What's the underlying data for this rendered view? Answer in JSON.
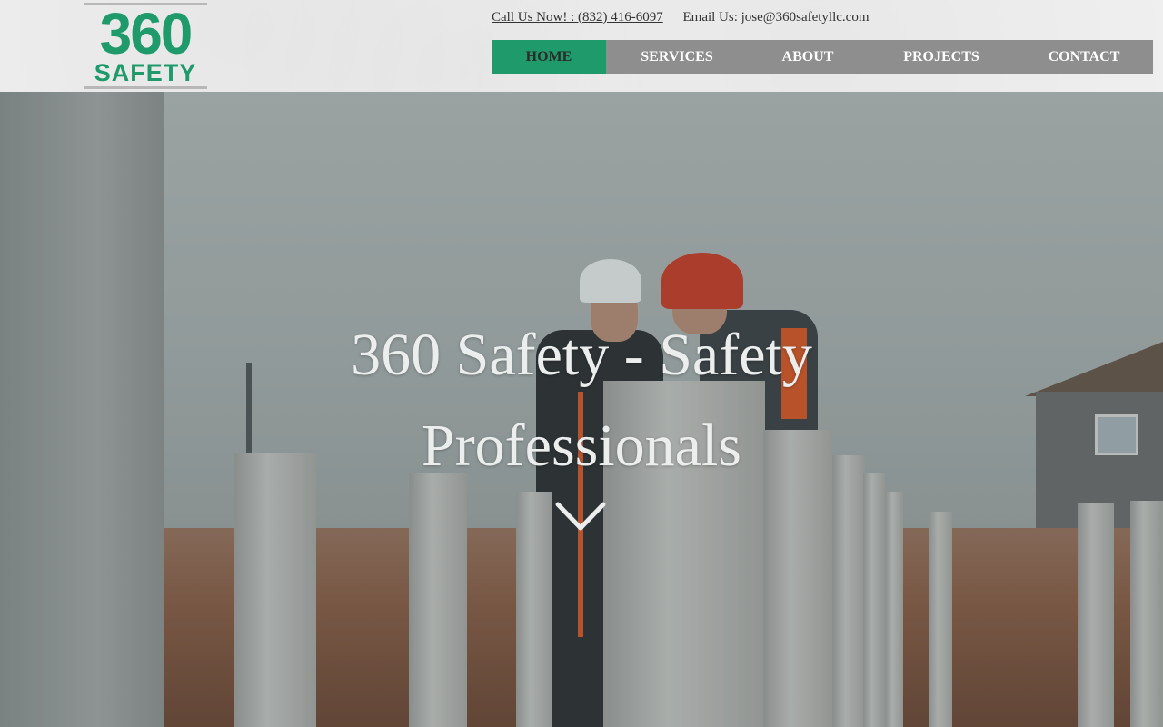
{
  "header": {
    "logo": {
      "number": "360",
      "word": "SAFETY"
    },
    "contact": {
      "phone_text": "Call Us Now! : (832) 416-6097",
      "email_text": "Email Us: jose@360safetyllc.com"
    },
    "nav": {
      "items": [
        {
          "label": "HOME",
          "active": true
        },
        {
          "label": "SERVICES",
          "active": false
        },
        {
          "label": "ABOUT",
          "active": false
        },
        {
          "label": "PROJECTS",
          "active": false
        },
        {
          "label": "CONTACT",
          "active": false
        }
      ]
    }
  },
  "hero": {
    "title_line1": "360 Safety - Safety",
    "title_line2": "Professionals",
    "scroll_icon": "chevron-down-icon"
  },
  "colors": {
    "brand_green": "#1f9a6b",
    "nav_gray": "#8e8e8e",
    "header_bg": "#efefef"
  }
}
